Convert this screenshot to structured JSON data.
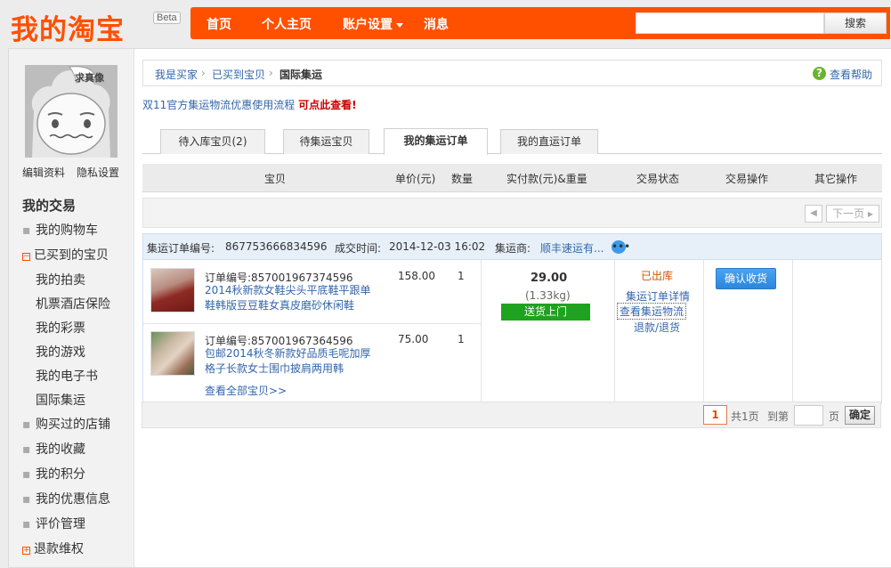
{
  "header": {
    "logo": "我的淘宝",
    "badge": "Beta",
    "nav": [
      {
        "label": "首页"
      },
      {
        "label": "个人主页"
      },
      {
        "label": "账户设置"
      },
      {
        "label": "消息"
      }
    ],
    "search": {
      "value": "",
      "button": "搜索"
    }
  },
  "sidebar": {
    "avatar_tag": "求真像",
    "edit_profile": "编辑资料",
    "privacy": "隐私设置",
    "section_title": "我的交易",
    "items": [
      "我的购物车",
      "已买到的宝贝",
      "我的拍卖",
      "机票酒店保险",
      "我的彩票",
      "我的游戏",
      "我的电子书",
      "国际集运",
      "购买过的店铺",
      "我的收藏",
      "我的积分",
      "我的优惠信息",
      "评价管理",
      "退款维权"
    ]
  },
  "breadcrumb": {
    "level1": "我是买家",
    "level2": "已买到宝贝",
    "current": "国际集运",
    "help": "查看帮助"
  },
  "promo": {
    "text": "双11官方集运物流优惠使用流程",
    "link": "可点此查看!"
  },
  "tabs": [
    {
      "label": "待入库宝贝(2)"
    },
    {
      "label": "待集运宝贝"
    },
    {
      "label": "我的集运订单"
    },
    {
      "label": "我的直运订单"
    }
  ],
  "table_headers": [
    "宝贝",
    "单价(元)",
    "数量",
    "实付款(元)&重量",
    "交易状态",
    "交易操作",
    "其它操作"
  ],
  "pager_top": {
    "prev": "◀",
    "next": "下一页"
  },
  "order": {
    "number_label": "集运订单编号:",
    "number": "867753666834596",
    "time_label": "成交时间:",
    "time": "2014-12-03 16:02",
    "carrier_label": "集运商:",
    "carrier": "顺丰速运有...",
    "items": [
      {
        "order_no": "订单编号:857001967374596",
        "title": "2014秋新款女鞋尖头平底鞋平跟单鞋韩版豆豆鞋女真皮磨砂休闲鞋",
        "price": "158.00",
        "qty": "1"
      },
      {
        "order_no": "订单编号:857001967364596",
        "title": "包邮2014秋冬新款好品质毛呢加厚格子长款女士围巾披肩两用韩",
        "price": "75.00",
        "qty": "1"
      }
    ],
    "view_all": "查看全部宝贝>>",
    "amount": "29.00",
    "weight": "(1.33kg)",
    "delivery": "送货上门",
    "status": "已出库",
    "status_links": [
      "集运订单详情",
      "查看集运物流",
      "退款/退货"
    ],
    "confirm": "确认收货"
  },
  "pager_bottom": {
    "current": "1",
    "total": "共1页",
    "goto": "到第",
    "page": "页",
    "ok": "确定"
  }
}
